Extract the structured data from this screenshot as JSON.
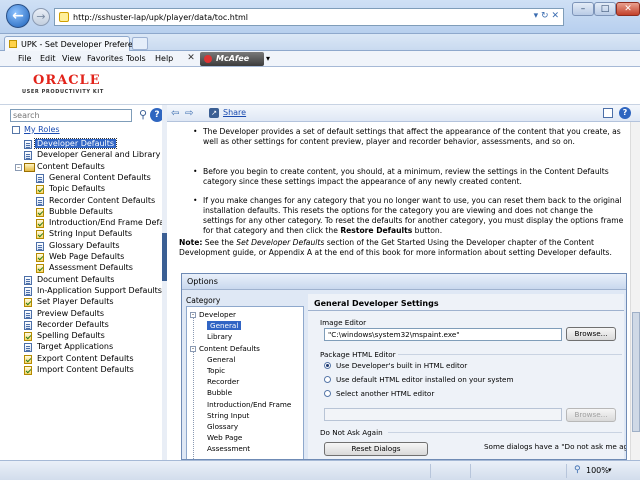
{
  "browser": {
    "url": "http://sshuster-lap/upk/player/data/toc.html",
    "tab_title": "UPK - Set Developer Prefere...",
    "menu": [
      "File",
      "Edit",
      "View",
      "Favorites",
      "Tools",
      "Help"
    ],
    "toolbar_brand": "McAfee",
    "zoom": "100%"
  },
  "header": {
    "logo": "ORACLE",
    "subtitle": "USER PRODUCTIVITY KIT"
  },
  "left": {
    "search_placeholder": "search",
    "my_roles": "My Roles",
    "tree": [
      {
        "label": "Developer Defaults",
        "icon": "doc",
        "indent": 0,
        "selected": true
      },
      {
        "label": "Developer General and Library Defaults",
        "icon": "doc",
        "indent": 0
      },
      {
        "label": "Content Defaults",
        "icon": "book",
        "indent": 0,
        "expanded": true
      },
      {
        "label": "General Content Defaults",
        "icon": "doc",
        "indent": 1
      },
      {
        "label": "Topic Defaults",
        "icon": "check",
        "indent": 1
      },
      {
        "label": "Recorder Content Defaults",
        "icon": "doc",
        "indent": 1
      },
      {
        "label": "Bubble Defaults",
        "icon": "check",
        "indent": 1
      },
      {
        "label": "Introduction/End Frame Defaults",
        "icon": "check",
        "indent": 1
      },
      {
        "label": "String Input Defaults",
        "icon": "check",
        "indent": 1
      },
      {
        "label": "Glossary Defaults",
        "icon": "doc",
        "indent": 1
      },
      {
        "label": "Web Page Defaults",
        "icon": "check",
        "indent": 1
      },
      {
        "label": "Assessment Defaults",
        "icon": "check",
        "indent": 1
      },
      {
        "label": "Document Defaults",
        "icon": "doc",
        "indent": 0
      },
      {
        "label": "In-Application Support Defaults",
        "icon": "doc",
        "indent": 0
      },
      {
        "label": "Set Player Defaults",
        "icon": "check",
        "indent": 0
      },
      {
        "label": "Preview Defaults",
        "icon": "doc",
        "indent": 0
      },
      {
        "label": "Recorder Defaults",
        "icon": "doc",
        "indent": 0
      },
      {
        "label": "Spelling Defaults",
        "icon": "check",
        "indent": 0
      },
      {
        "label": "Target Applications",
        "icon": "doc",
        "indent": 0
      },
      {
        "label": "Export Content Defaults",
        "icon": "check",
        "indent": 0
      },
      {
        "label": "Import Content Defaults",
        "icon": "check",
        "indent": 0
      }
    ]
  },
  "right": {
    "share": "Share",
    "bullets": [
      "The Developer provides a set of default settings that affect the appearance of the content that you create, as well as other settings for content preview, player and recorder behavior, assessments, and so on.",
      "Before you begin to create content, you should, at a minimum, review the settings in the Content Defaults category since these settings impact the appearance of any newly created content.",
      "If you make changes for any category that you no longer want to use, you can reset them back to the original installation defaults. This resets the options for the category you are viewing and does not change the settings for any other category. To reset the defaults for another category, you must display the options frame for that category and then click the "
    ],
    "bullet3_bold": "Restore Defaults",
    "bullet3_end": " button.",
    "note_label": "Note:",
    "note_pre": " See the ",
    "note_italic": "Set Developer Defaults",
    "note_post": " section of the Get Started Using the Developer chapter of the Content Development guide, or Appendix A at the end of this book for more information about setting Developer defaults."
  },
  "dialog": {
    "title": "Options",
    "category_header": "Category",
    "tree": [
      {
        "label": "Developer",
        "level": 0
      },
      {
        "label": "General",
        "level": 1,
        "selected": true
      },
      {
        "label": "Library",
        "level": 1
      },
      {
        "label": "Content Defaults",
        "level": 0
      },
      {
        "label": "General",
        "level": 1
      },
      {
        "label": "Topic",
        "level": 1
      },
      {
        "label": "Recorder",
        "level": 1
      },
      {
        "label": "Bubble",
        "level": 1
      },
      {
        "label": "Introduction/End Frame",
        "level": 1
      },
      {
        "label": "String Input",
        "level": 1
      },
      {
        "label": "Glossary",
        "level": 1
      },
      {
        "label": "Web Page",
        "level": 1
      },
      {
        "label": "Assessment",
        "level": 1
      }
    ],
    "section_title": "General Developer Settings",
    "image_editor_label": "Image Editor",
    "image_editor_value": "\"C:\\windows\\system32\\mspaint.exe\"",
    "browse": "Browse...",
    "package_label": "Package HTML Editor",
    "radios": [
      {
        "label": "Use Developer's built in HTML editor",
        "checked": true
      },
      {
        "label": "Use default HTML editor installed on your system",
        "checked": false
      },
      {
        "label": "Select another HTML editor",
        "checked": false
      }
    ],
    "dna_label": "Do Not Ask Again",
    "reset_button": "Reset Dialogs",
    "dna_desc": "Some dialogs have a \"Do not ask me again\""
  }
}
